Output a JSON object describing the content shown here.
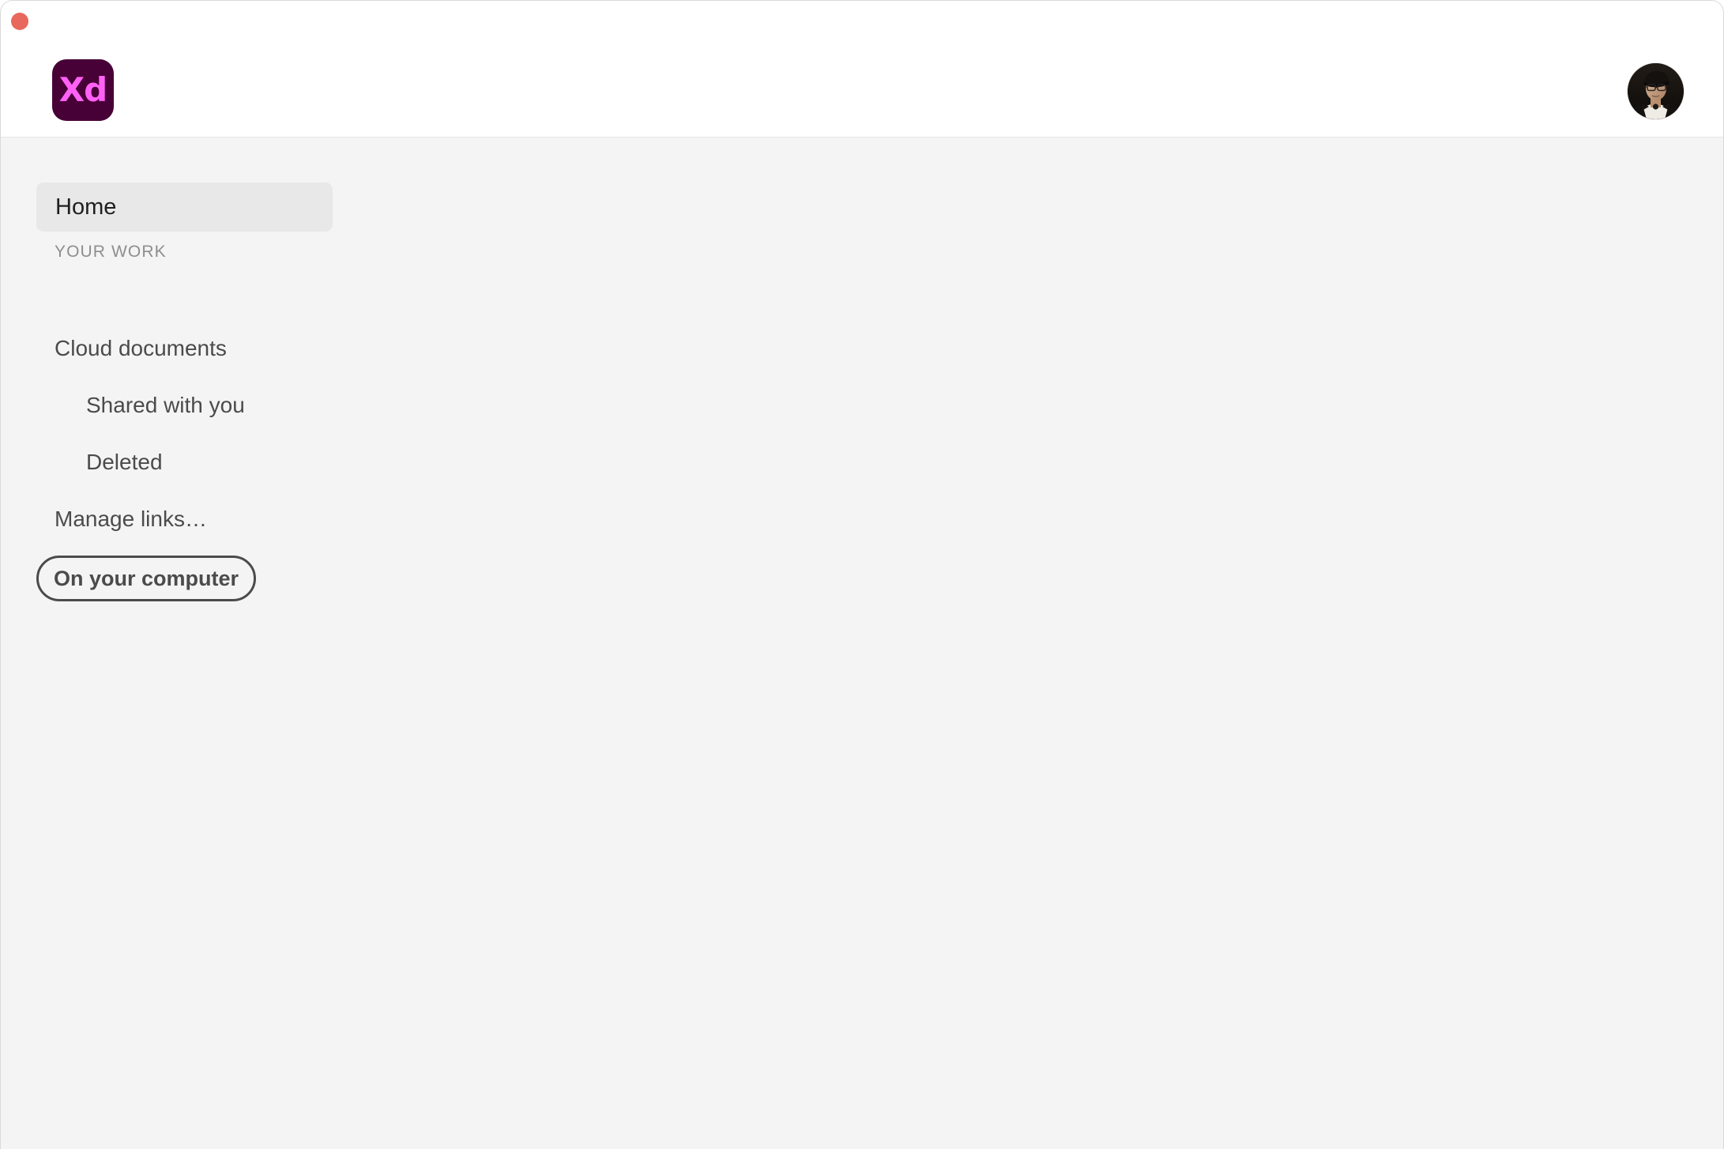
{
  "window": {
    "title_bar": {
      "close_button": "close-button",
      "app_logo_text": "Xd",
      "app_logo_bg_color": "#470137",
      "app_logo_text_color": "#FF61F6",
      "close_button_color": "#E8685D",
      "avatar_alt": "user-avatar"
    },
    "background_color": "#F4F4F4",
    "header_background_color": "#FFFFFF"
  },
  "sidebar": {
    "home": {
      "label": "Home",
      "selected": true,
      "selected_bg_color": "#E8E8E8"
    },
    "section_label": "YOUR WORK",
    "items": [
      {
        "label": "Cloud documents",
        "indent": 0
      },
      {
        "label": "Shared with you",
        "indent": 1
      },
      {
        "label": "Deleted",
        "indent": 1
      },
      {
        "label": "Manage links…",
        "indent": 0
      }
    ],
    "on_your_computer_button": {
      "label": "On your computer",
      "border_color": "#4B4B4B"
    }
  }
}
